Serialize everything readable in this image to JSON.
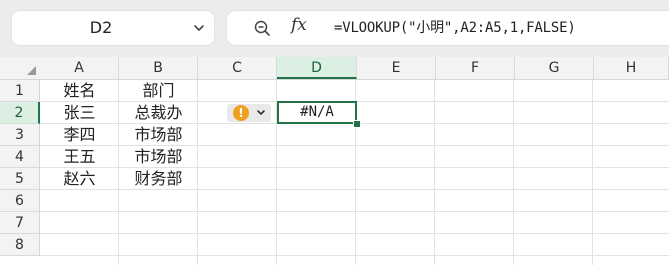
{
  "toolbar": {
    "name_box": "D2",
    "formula": "=VLOOKUP(\"小明\",A2:A5,1,FALSE)",
    "fx_label": "fx",
    "zoom_icon": "zoom-icon"
  },
  "sheet": {
    "columns": [
      "A",
      "B",
      "C",
      "D",
      "E",
      "F",
      "G",
      "H"
    ],
    "selected_column": "D",
    "rows": [
      "1",
      "2",
      "3",
      "4",
      "5",
      "6",
      "7",
      "8"
    ],
    "selected_row": "2",
    "cells": {
      "A1": "姓名",
      "B1": "部门",
      "A2": "张三",
      "B2": "总裁办",
      "A3": "李四",
      "B3": "市场部",
      "A4": "王五",
      "B4": "市场部",
      "A5": "赵六",
      "B5": "财务部",
      "D2": "#N/A"
    },
    "error_indicator": "warning-icon"
  },
  "colors": {
    "accent": "#217346",
    "warning": "#f0a020"
  }
}
